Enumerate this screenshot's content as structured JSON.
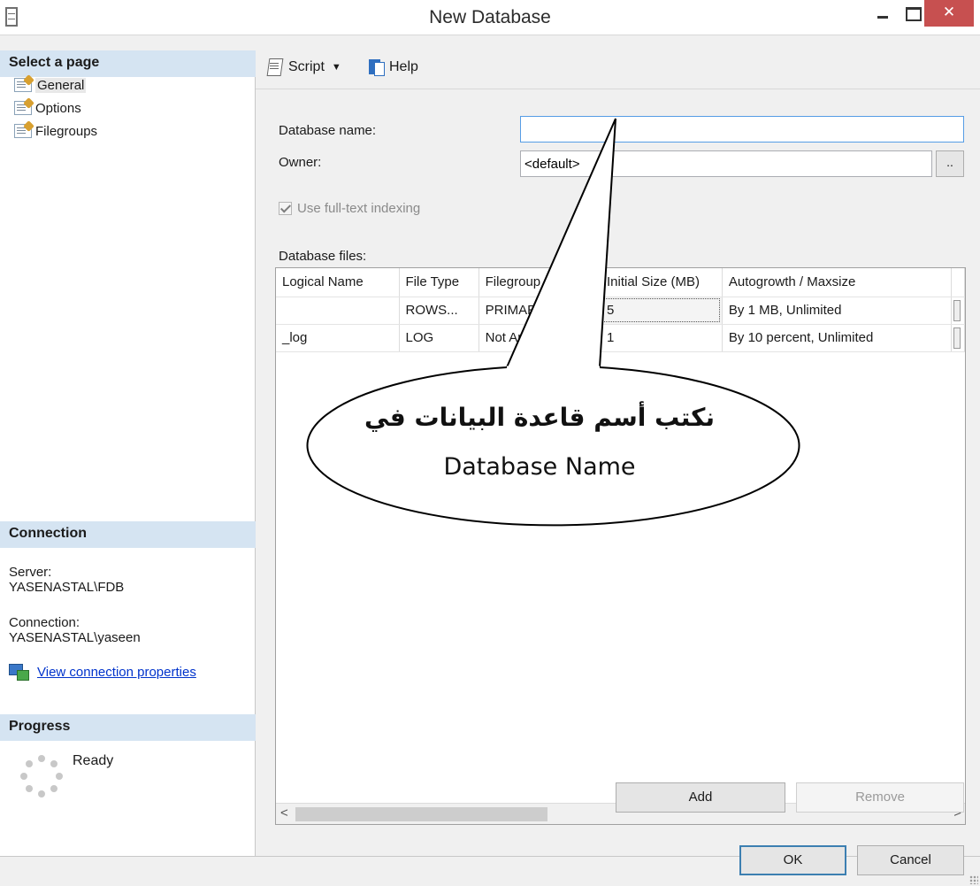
{
  "window": {
    "title": "New Database",
    "close_glyph": "✕"
  },
  "left_pane": {
    "select_page_header": "Select a page",
    "pages": [
      {
        "label": "General",
        "selected": true
      },
      {
        "label": "Options",
        "selected": false
      },
      {
        "label": "Filegroups",
        "selected": false
      }
    ],
    "connection_header": "Connection",
    "server_label": "Server:",
    "server_value": "YASENASTAL\\FDB",
    "connection_label": "Connection:",
    "connection_value": "YASENASTAL\\yaseen",
    "view_connection_link": "View connection properties",
    "progress_header": "Progress",
    "progress_status": "Ready"
  },
  "toolbar": {
    "script_label": "Script",
    "help_label": "Help"
  },
  "form": {
    "database_name_label": "Database name:",
    "database_name_value": "",
    "owner_label": "Owner:",
    "owner_value": "<default>",
    "owner_browse_label": "..",
    "fulltext_label": "Use full-text indexing",
    "fulltext_checked": true,
    "database_files_label": "Database files:"
  },
  "grid": {
    "columns": [
      "Logical Name",
      "File Type",
      "Filegroup",
      "Initial Size (MB)",
      "Autogrowth / Maxsize"
    ],
    "rows": [
      {
        "logical_name": "",
        "file_type": "ROWS...",
        "filegroup": "PRIMARY",
        "initial_size": "5",
        "autogrowth": "By 1 MB, Unlimited"
      },
      {
        "logical_name": "_log",
        "file_type": "LOG",
        "filegroup": "Not Applicable",
        "initial_size": "1",
        "autogrowth": "By 10 percent, Unlimited"
      }
    ],
    "scroll_left_glyph": "<",
    "scroll_right_glyph": ">"
  },
  "buttons": {
    "add": "Add",
    "remove": "Remove",
    "ok": "OK",
    "cancel": "Cancel"
  },
  "callout": {
    "arabic_text": "نكتب أسم قاعدة البيانات في",
    "english_text": "Database Name"
  }
}
